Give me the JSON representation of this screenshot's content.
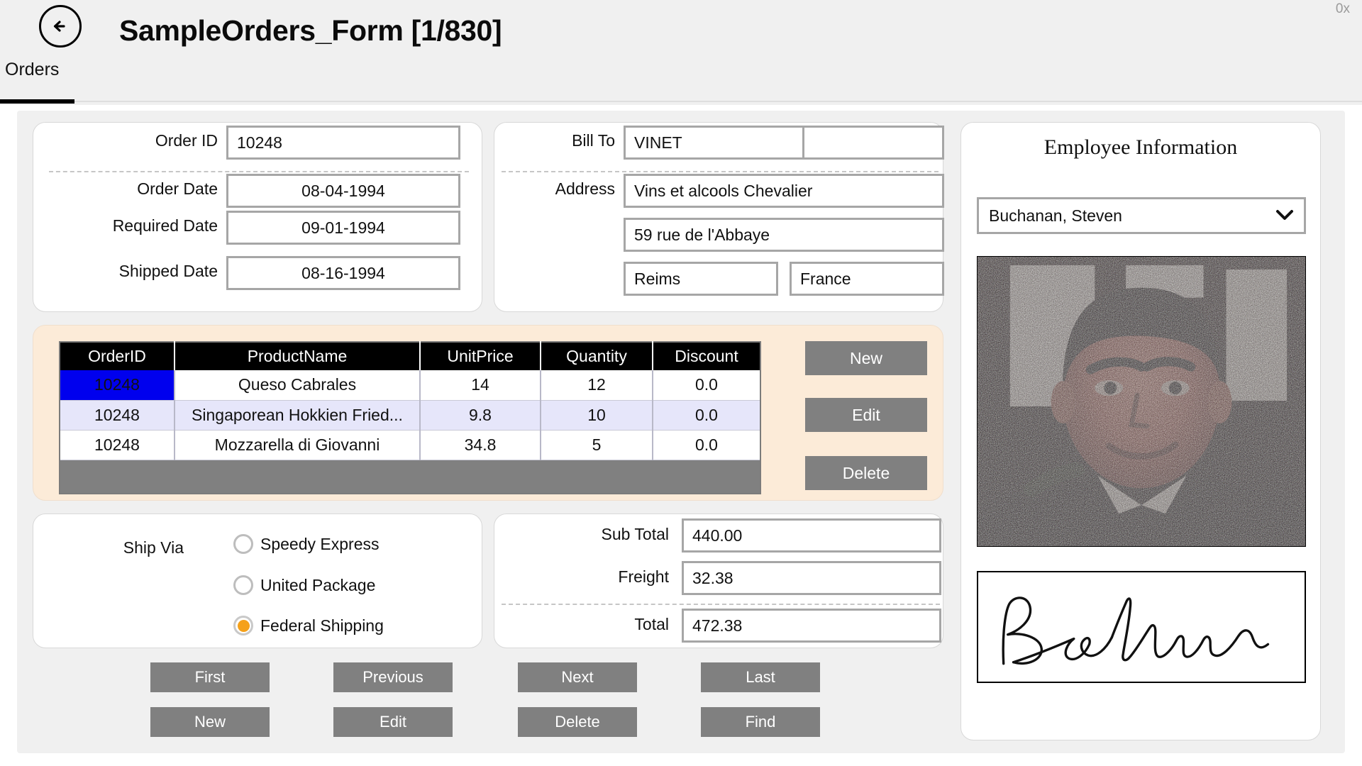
{
  "window": {
    "title": "SampleOrders_Form [1/830]",
    "back_icon": "back-arrow-icon",
    "corner_label": "0x",
    "tab": "Orders"
  },
  "order_panel": {
    "fields": [
      {
        "label": "Order ID",
        "value": "10248"
      },
      {
        "label": "Order Date",
        "value": "08-04-1994"
      },
      {
        "label": "Required Date",
        "value": "09-01-1994"
      },
      {
        "label": "Shipped Date",
        "value": "08-16-1994"
      }
    ]
  },
  "bill_panel": {
    "bill_to_label": "Bill To",
    "bill_to_value": "VINET",
    "address_label": "Address",
    "address_line1": "Vins et alcools Chevalier",
    "address_line2": "59 rue de l'Abbaye",
    "address_city": "Reims",
    "address_country": "France"
  },
  "details_grid": {
    "columns": [
      "OrderID",
      "ProductName",
      "UnitPrice",
      "Quantity",
      "Discount"
    ],
    "rows": [
      {
        "OrderID": "10248",
        "ProductName": "Queso Cabrales",
        "UnitPrice": "14",
        "Quantity": "12",
        "Discount": "0.0"
      },
      {
        "OrderID": "10248",
        "ProductName": "Singaporean Hokkien Fried...",
        "UnitPrice": "9.8",
        "Quantity": "10",
        "Discount": "0.0"
      },
      {
        "OrderID": "10248",
        "ProductName": "Mozzarella di Giovanni",
        "UnitPrice": "34.8",
        "Quantity": "5",
        "Discount": "0.0"
      }
    ],
    "selected_row": 0,
    "selected_column": "OrderID",
    "buttons": {
      "new": "New",
      "edit": "Edit",
      "delete": "Delete"
    }
  },
  "ship_via": {
    "label": "Ship Via",
    "options": [
      {
        "label": "Speedy Express",
        "selected": false
      },
      {
        "label": "United Package",
        "selected": false
      },
      {
        "label": "Federal Shipping",
        "selected": true
      }
    ],
    "selected_color": "#f5a11a"
  },
  "totals": {
    "sub_total_label": "Sub Total",
    "sub_total_value": "440.00",
    "freight_label": "Freight",
    "freight_value": "32.38",
    "total_label": "Total",
    "total_value": "472.38"
  },
  "nav_buttons": {
    "row1": [
      "First",
      "Previous",
      "Next",
      "Last"
    ],
    "row2": [
      "New",
      "Edit",
      "Delete",
      "Find"
    ]
  },
  "employee": {
    "title": "Employee Information",
    "selected": "Buchanan, Steven",
    "dropdown_icon": "chevron-down-icon",
    "photo_alt": "employee-photo",
    "signature_alt": "Buchanan"
  },
  "colors": {
    "page_bg": "#ffffff",
    "card_bg": "#f0f0f0",
    "grid_panel_bg": "#fcebd8",
    "header_bg": "#000000",
    "selection_blue": "#0000ee",
    "alt_row": "#e6e6fa",
    "button_gray": "#808080",
    "accent_orange": "#f5a11a"
  }
}
